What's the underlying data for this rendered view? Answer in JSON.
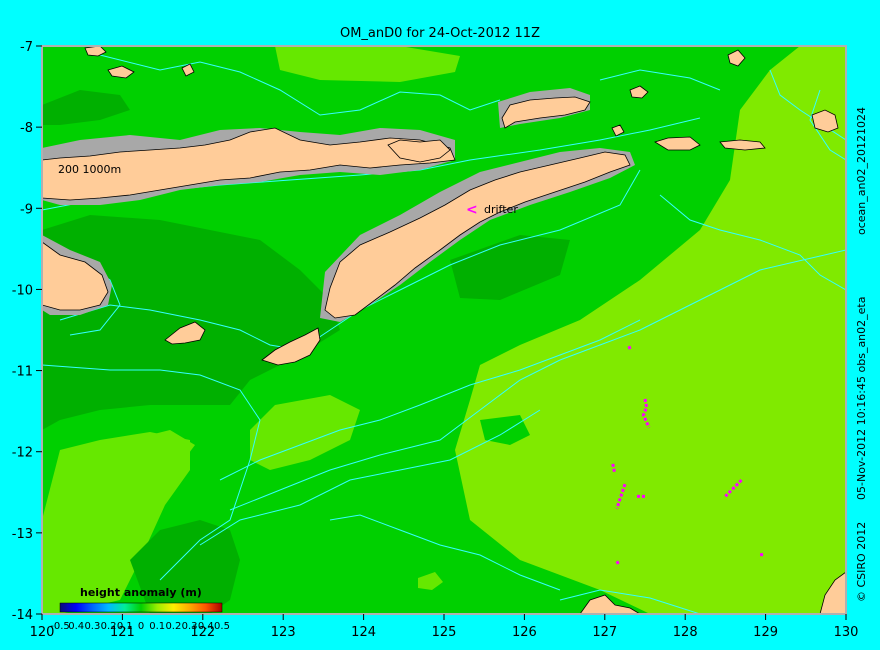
{
  "chart_data": {
    "type": "heatmap",
    "title": "OM_anD0 for 24-Oct-2012 11Z",
    "xlabel": "",
    "ylabel": "",
    "xlim": [
      120,
      130
    ],
    "ylim": [
      -14,
      -7
    ],
    "x_ticks": [
      120,
      121,
      122,
      123,
      124,
      125,
      126,
      127,
      128,
      129,
      130
    ],
    "y_ticks": [
      -7,
      -8,
      -9,
      -10,
      -11,
      -12,
      -13,
      -14
    ],
    "annotations": {
      "depth_contours": "200 1000m",
      "drifter_label": "drifter"
    },
    "legend": {
      "title": "height anomaly (m)",
      "ticks": [
        "-0.5",
        "0.4",
        "0.3",
        "0.2",
        "0.1",
        "0",
        "0.1",
        "0.2",
        "0.3",
        "0.4",
        "0.5"
      ],
      "range": [
        -0.5,
        0.5
      ]
    },
    "side_text": {
      "product": "ocean_an02_20121024",
      "line1": "05-Nov-2012 10:16:45 obs_an02_eta",
      "line2": "© CSIRO 2012"
    },
    "colors": {
      "background": "#00ffff",
      "land": "#ffcc99",
      "shelf": "#a8a8a8",
      "contour": "#33ffff",
      "drifter": "#ff00ff",
      "green_dark": "#00b000",
      "green_mid": "#00d000",
      "green_light": "#66e800",
      "green_yellow": "#80ea00",
      "yellow_green": "#b4f000"
    },
    "drifter_tracks_lonlat": [
      [
        [
          127.3,
          -10.7
        ],
        [
          127.32,
          -10.75
        ]
      ],
      [
        [
          127.5,
          -11.35
        ],
        [
          127.52,
          -11.45
        ],
        [
          127.48,
          -11.55
        ],
        [
          127.55,
          -11.7
        ]
      ],
      [
        [
          127.1,
          -12.15
        ],
        [
          127.12,
          -12.25
        ]
      ],
      [
        [
          127.25,
          -12.4
        ],
        [
          127.2,
          -12.55
        ],
        [
          127.15,
          -12.7
        ]
      ],
      [
        [
          127.4,
          -12.55
        ],
        [
          127.5,
          -12.55
        ]
      ],
      [
        [
          128.7,
          -12.35
        ],
        [
          128.6,
          -12.45
        ],
        [
          128.5,
          -12.55
        ]
      ],
      [
        [
          127.15,
          -13.35
        ],
        [
          127.18,
          -13.4
        ]
      ],
      [
        [
          128.95,
          -13.25
        ],
        [
          128.95,
          -13.3
        ]
      ]
    ]
  }
}
